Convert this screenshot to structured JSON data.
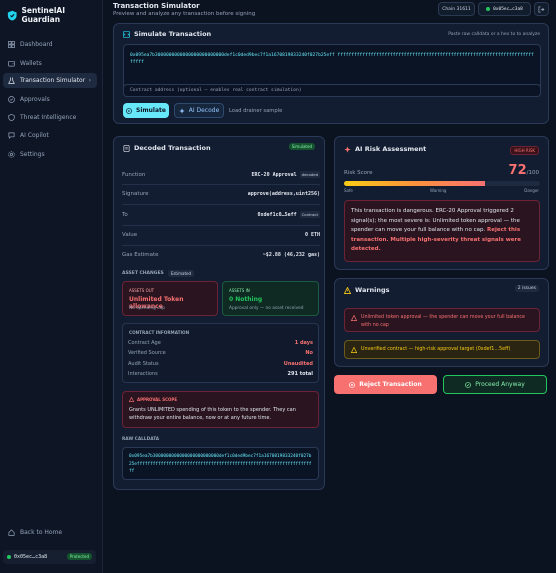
{
  "app": {
    "name": "SentinelAI Guardian"
  },
  "sidebar": {
    "items": [
      {
        "label": "Dashboard"
      },
      {
        "label": "Wallets"
      },
      {
        "label": "Transaction Simulator"
      },
      {
        "label": "Approvals"
      },
      {
        "label": "Threat Intelligence"
      },
      {
        "label": "AI Copilot"
      },
      {
        "label": "Settings"
      }
    ],
    "back_label": "Back to Home",
    "wallet_address": "0x05ec…c3a8",
    "wallet_status": "Protected"
  },
  "header": {
    "title": "Transaction Simulator",
    "subtitle": "Preview and analyze any transaction before signing",
    "chain": "Chain 31611",
    "wallet": "0x05ec…c3a8"
  },
  "simulate": {
    "title": "Simulate Transaction",
    "hint": "Paste raw calldata or a hex to to analyze",
    "calldata": "0x095ea7b3000000000000000000000000def1c0ded9bec7f1a1670819833240f027b25eff ffffffffffffffffffffffffffffffffffffffffffffffffffffffffffffffffffffffffffff",
    "contract_placeholder": "Contract address (optional — enables real contract simulation)",
    "simulate_label": "Simulate",
    "ai_decode_label": "AI Decode",
    "load_sample_label": "Load drainer sample"
  },
  "decoded": {
    "title": "Decoded Transaction",
    "badge": "Simulated",
    "rows": [
      {
        "k": "Function",
        "v": "ERC-20 Approval",
        "tag": "decoded"
      },
      {
        "k": "Signature",
        "v": "approve(address,uint256)"
      },
      {
        "k": "To",
        "v": "0xdef1c0…5eff",
        "tag": "Contract"
      },
      {
        "k": "Value",
        "v": "0 ETH"
      },
      {
        "k": "Gas Estimate",
        "v": "~$2.88 (46,232 gas)"
      }
    ],
    "asset_changes_label": "ASSET CHANGES",
    "asset_changes_badge": "Estimated",
    "assets_out": {
      "label": "ASSETS OUT",
      "value": "Unlimited Token allowance",
      "sub": "No spending cap"
    },
    "assets_in": {
      "label": "ASSETS IN",
      "value": "0 Nothing",
      "sub": "Approval only — no asset received"
    },
    "contract_info": {
      "label": "CONTRACT INFORMATION",
      "rows": [
        {
          "k": "Contract Age",
          "v": "1 days"
        },
        {
          "k": "Verified Source",
          "v": "No"
        },
        {
          "k": "Audit Status",
          "v": "Unaudited"
        },
        {
          "k": "Interactions",
          "v": "291 total"
        }
      ]
    },
    "approval": {
      "label": "APPROVAL SCOPE",
      "text": "Grants UNLIMITED spending of this token to the spender. They can withdraw your entire balance, now or at any future time."
    },
    "raw_label": "RAW CALLDATA",
    "raw_calldata": "0x095ea7b3000000000000000000000000def1c0ded9bec7f1a1670819833240f027b25effffffffffffffffffffffffffffffffffffffffffffffffffffffffffffffffffff"
  },
  "risk": {
    "title": "AI Risk Assessment",
    "badge": "HIGH RISK",
    "score_label": "Risk Score",
    "score": "72",
    "score_max": "/100",
    "score_fraction": 0.72,
    "scale_safe": "Safe",
    "scale_warning": "Warning",
    "scale_danger": "Danger",
    "summary_normal": "This transaction is dangerous. ERC-20 Approval triggered 2 signal(s); the most severe is: Unlimited token approval — the spender can move your full balance with no cap.",
    "summary_highlight": "Reject this transaction. Multiple high-severity threat signals were detected."
  },
  "warnings": {
    "title": "Warnings",
    "count": "2 issues",
    "items": [
      {
        "text": "Unlimited token approval — the spender can move your full balance with no cap"
      },
      {
        "text": "Unverified contract — high-risk approval target (0xdef1…5eff)"
      }
    ]
  },
  "actions": {
    "reject_label": "Reject Transaction",
    "proceed_label": "Proceed Anyway"
  },
  "colors": {
    "accent": "#22d3ee",
    "danger": "#f87171",
    "warning": "#facc15",
    "success": "#22c55e"
  }
}
